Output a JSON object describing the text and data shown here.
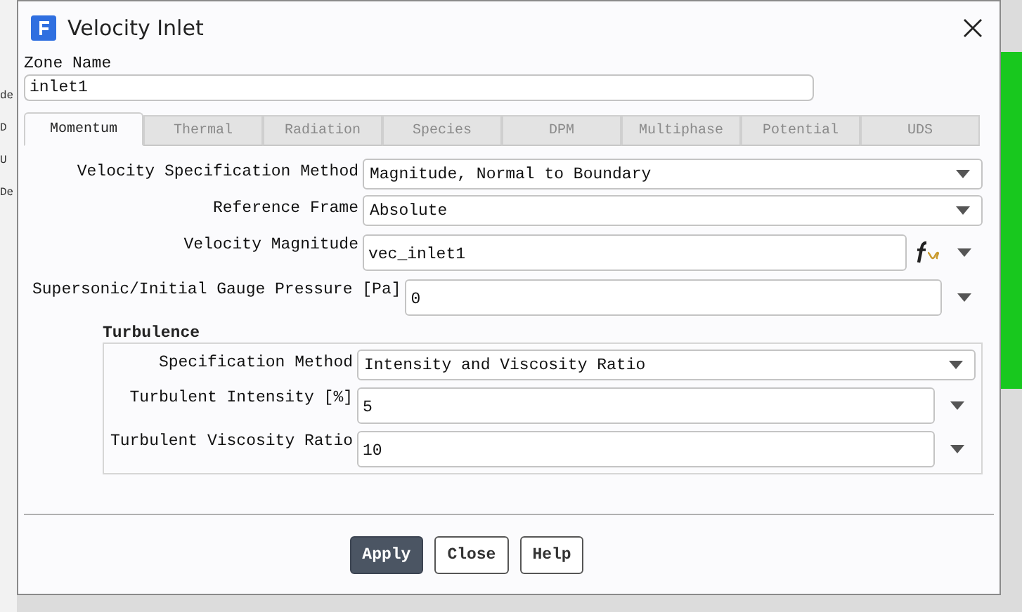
{
  "background_text": [
    "de",
    "D",
    "U",
    "De"
  ],
  "window": {
    "title": "Velocity Inlet"
  },
  "zone_name": {
    "label": "Zone Name",
    "value": "inlet1"
  },
  "tabs": [
    {
      "label": "Momentum",
      "selected": true
    },
    {
      "label": "Thermal",
      "selected": false
    },
    {
      "label": "Radiation",
      "selected": false
    },
    {
      "label": "Species",
      "selected": false
    },
    {
      "label": "DPM",
      "selected": false
    },
    {
      "label": "Multiphase",
      "selected": false
    },
    {
      "label": "Potential",
      "selected": false
    },
    {
      "label": "UDS",
      "selected": false
    }
  ],
  "fields": [
    {
      "kind": "dropdown",
      "label": "Velocity Specification Method",
      "value": "Magnitude, Normal to Boundary"
    },
    {
      "kind": "dropdown",
      "label": "Reference Frame",
      "value": "Absolute"
    },
    {
      "kind": "expression",
      "label": "Velocity Magnitude",
      "value": "vec_inlet1"
    },
    {
      "kind": "number",
      "label": "Supersonic/Initial Gauge Pressure [Pa]",
      "value": "0"
    }
  ],
  "turbulence": {
    "title": "Turbulence",
    "fields": [
      {
        "kind": "dropdown",
        "label": "Specification Method",
        "value": "Intensity and Viscosity Ratio"
      },
      {
        "kind": "number",
        "label": "Turbulent Intensity [%]",
        "value": "5"
      },
      {
        "kind": "number",
        "label": "Turbulent Viscosity Ratio",
        "value": "10"
      }
    ]
  },
  "buttons": [
    {
      "label": "Apply",
      "primary": true
    },
    {
      "label": "Close",
      "primary": false
    },
    {
      "label": "Help",
      "primary": false
    }
  ]
}
